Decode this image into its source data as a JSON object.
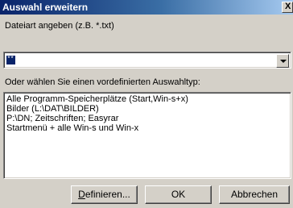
{
  "window": {
    "title": "Auswahl erweitern",
    "close_glyph": "X"
  },
  "filetype": {
    "label": "Dateiart angeben (z.B. *.txt)",
    "value": "**"
  },
  "predefined": {
    "label": "Oder wählen Sie einen vordefinierten Auswahltyp:",
    "items": [
      "Alle Programm-Speicherplätze (Start,Win-s+x)",
      "Bilder  (L:\\DAT\\BILDER)",
      "P:\\DN; Zeitschriften; Easyrar",
      "Startmenü + alle Win-s und Win-x"
    ]
  },
  "buttons": {
    "define_first": "D",
    "define_rest": "efinieren...",
    "ok": "OK",
    "cancel": "Abbrechen"
  }
}
